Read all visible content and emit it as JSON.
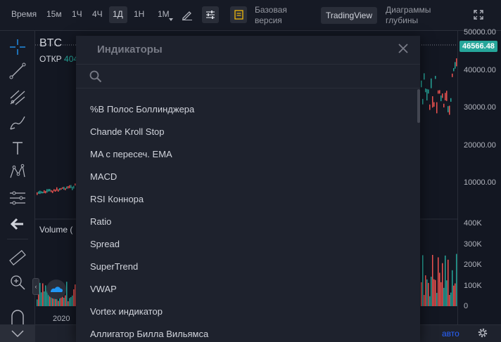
{
  "topbar": {
    "time_label": "Время",
    "intervals": [
      "15м",
      "1Ч",
      "4Ч",
      "1Д",
      "1Н",
      "1М"
    ],
    "active_interval": "1Д",
    "basic_version_line1": "Базовая",
    "basic_version_line2": "версия",
    "tradingview_label": "TradingView",
    "depth_line1": "Диаграммы",
    "depth_line2": "глубины"
  },
  "chart": {
    "symbol": "BTC",
    "open_label": "ОТКР",
    "open_value": "404",
    "volume_label": "Volume (",
    "year_label": "2020",
    "price_axis": [
      "50000.00",
      "40000.00",
      "30000.00",
      "20000.00",
      "10000.00"
    ],
    "volume_axis": [
      "400K",
      "300K",
      "200K",
      "100K",
      "0"
    ],
    "last_price": "46566.48",
    "auto_label": "авто",
    "up_color": "#26a69a",
    "down_color": "#ef5350"
  },
  "modal": {
    "title": "Индикаторы",
    "search_placeholder": "",
    "search_value": "",
    "items": [
      "%B Полос Боллинджера",
      "Chande Kroll Stop",
      "MA с пересеч. EMA",
      "MACD",
      "RSI Коннора",
      "Ratio",
      "Spread",
      "SuperTrend",
      "VWAP",
      "Vortex индикатор",
      "Аллигатор Билла Вильямса"
    ]
  },
  "icons": {
    "left_tools": [
      "crosshair-icon",
      "trend-line-icon",
      "fib-icon",
      "brush-icon",
      "text-icon",
      "pattern-icon",
      "prediction-icon",
      "back-arrow-icon",
      "ruler-icon",
      "zoom-in-icon",
      "magnet-icon",
      "chevron-down-icon"
    ],
    "top": [
      "pencil-icon",
      "settings-sliders-icon",
      "chart-doc-icon",
      "fullscreen-icon"
    ],
    "modal": [
      "search-icon",
      "close-icon"
    ]
  }
}
